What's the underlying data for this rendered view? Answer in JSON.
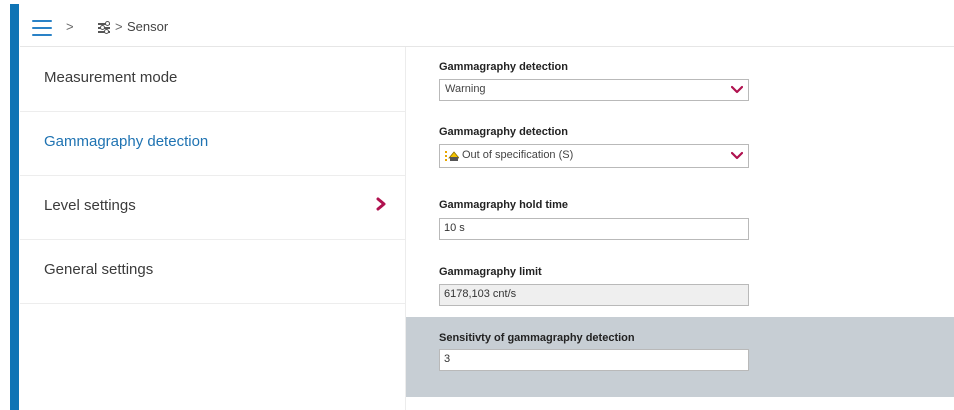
{
  "header": {
    "breadcrumb_sep1": ">",
    "breadcrumb_sep2": ">",
    "breadcrumb_current": "Sensor"
  },
  "sidebar": {
    "items": [
      {
        "label": "Measurement mode",
        "active": false
      },
      {
        "label": "Gammagraphy detection",
        "active": true
      },
      {
        "label": "Level settings",
        "active": false
      },
      {
        "label": "General settings",
        "active": false
      }
    ]
  },
  "fields": [
    {
      "label": "Gammagraphy detection",
      "type": "select",
      "value": "Warning"
    },
    {
      "label": "Gammagraphy detection",
      "type": "select",
      "value": "Out of specification (S)",
      "icon": "out-of-specification-icon"
    },
    {
      "label": "Gammagraphy hold time",
      "type": "input",
      "value": "10 s"
    },
    {
      "label": "Gammagraphy limit",
      "type": "readonly",
      "value": "6178,103 cnt/s",
      "icon": "lock-icon"
    },
    {
      "label": "Sensitivty of gammagraphy detection",
      "type": "input",
      "value": "3"
    }
  ],
  "colors": {
    "accent": "#0f74b5",
    "active_text": "#1f73b2",
    "chevron": "#b0124f",
    "highlight_bg": "#c7ced4"
  }
}
